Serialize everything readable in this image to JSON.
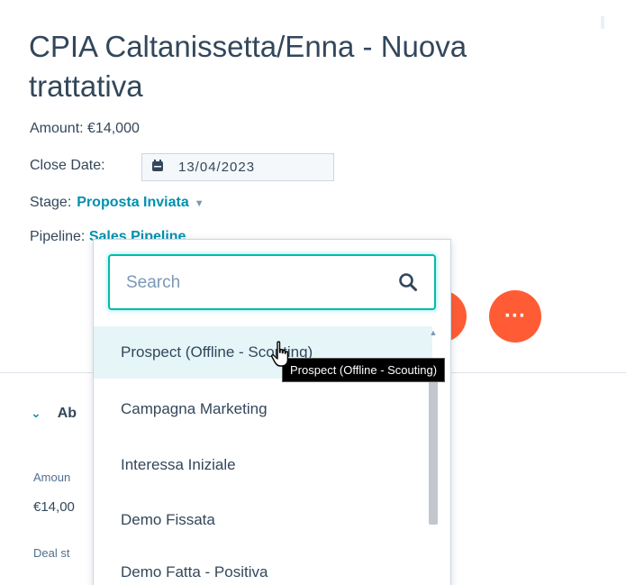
{
  "record": {
    "title": "CPIA Caltanissetta/Enna - Nuova trattativa",
    "amount_text": "Amount: €14,000",
    "close_date_label": "Close Date:",
    "close_date_value": "13/04/2023",
    "stage_label": "Stage:",
    "stage_value": "Proposta Inviata",
    "pipeline_label": "Pipeline:",
    "pipeline_value": "Sales Pipeline"
  },
  "actions": {
    "more_label": "···"
  },
  "about_section": {
    "title": "Ab",
    "amount_label": "Amoun",
    "amount_value": "€14,00",
    "deal_stage_label": "Deal st"
  },
  "dropdown": {
    "search_placeholder": "Search",
    "options": [
      "Prospect (Offline - Scouting)",
      "Campagna Marketing",
      "Interessa Iniziale",
      "Demo Fissata",
      "Demo Fatta - Positiva"
    ],
    "hovered_index": 0
  },
  "tooltip": {
    "text": "Prospect (Offline - Scouting)"
  },
  "colors": {
    "accent_link": "#0091ae",
    "action_orange": "#ff5c35",
    "search_focus": "#00bda5",
    "hover_row": "#e5f5f8"
  },
  "icons": {
    "calendar": "calendar-icon",
    "search": "search-icon",
    "caret": "caret-down-icon",
    "chevron": "chevron-down-icon",
    "more": "more-icon",
    "cursor": "hand-cursor-icon"
  }
}
